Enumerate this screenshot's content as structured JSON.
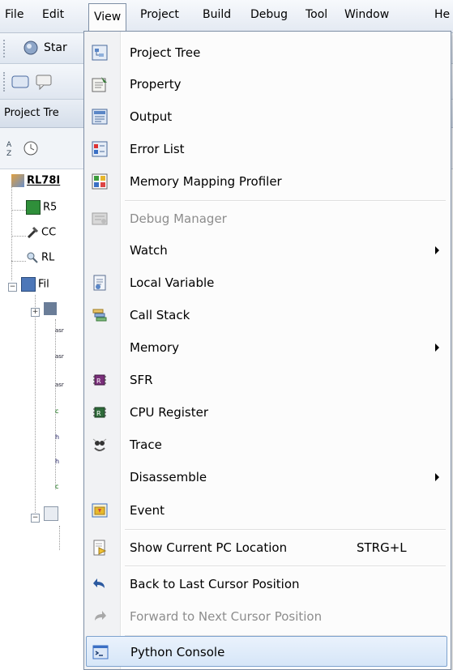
{
  "menubar": {
    "items": [
      "File",
      "Edit",
      "View",
      "Project",
      "Build",
      "Debug",
      "Tool",
      "Window",
      "He"
    ]
  },
  "toolbar": {
    "start_label": "Star"
  },
  "panel": {
    "title": "Project Tre"
  },
  "tree": {
    "root": "RL78I",
    "nodes": [
      "R5",
      "CC",
      "RL",
      "Fil"
    ],
    "file_tags": [
      "asr",
      "asr",
      "asr",
      "c",
      "h",
      "h",
      "c"
    ]
  },
  "menu": {
    "items": [
      {
        "label": "Project Tree",
        "icon": "project-tree-icon"
      },
      {
        "label": "Property",
        "icon": "property-icon"
      },
      {
        "label": "Output",
        "icon": "output-icon"
      },
      {
        "label": "Error List",
        "icon": "error-list-icon"
      },
      {
        "label": "Memory Mapping Profiler",
        "icon": "memory-mapping-icon"
      },
      {
        "label": "Debug Manager",
        "icon": "debug-manager-icon",
        "disabled": true
      },
      {
        "label": "Watch",
        "submenu": true
      },
      {
        "label": "Local Variable",
        "icon": "local-variable-icon"
      },
      {
        "label": "Call Stack",
        "icon": "call-stack-icon"
      },
      {
        "label": "Memory",
        "submenu": true
      },
      {
        "label": "SFR",
        "icon": "sfr-chip-icon"
      },
      {
        "label": "CPU Register",
        "icon": "cpu-register-icon"
      },
      {
        "label": "Trace",
        "icon": "trace-icon"
      },
      {
        "label": "Disassemble",
        "submenu": true
      },
      {
        "label": "Event",
        "icon": "event-icon"
      },
      {
        "label": "Show Current PC Location",
        "shortcut": "STRG+L",
        "icon": "pc-location-icon"
      },
      {
        "label": "Back to Last Cursor Position",
        "icon": "back-arrow-icon"
      },
      {
        "label": "Forward to Next Cursor Position",
        "icon": "forward-arrow-icon",
        "disabled": true
      },
      {
        "label": "Python Console",
        "icon": "python-console-icon",
        "highlighted": true
      }
    ]
  },
  "colors": {
    "menu_border": "#7d8ea5",
    "highlight_border": "#7da2ce",
    "disabled_text": "#8d8d8d",
    "gutter": "#f1f2f4"
  }
}
